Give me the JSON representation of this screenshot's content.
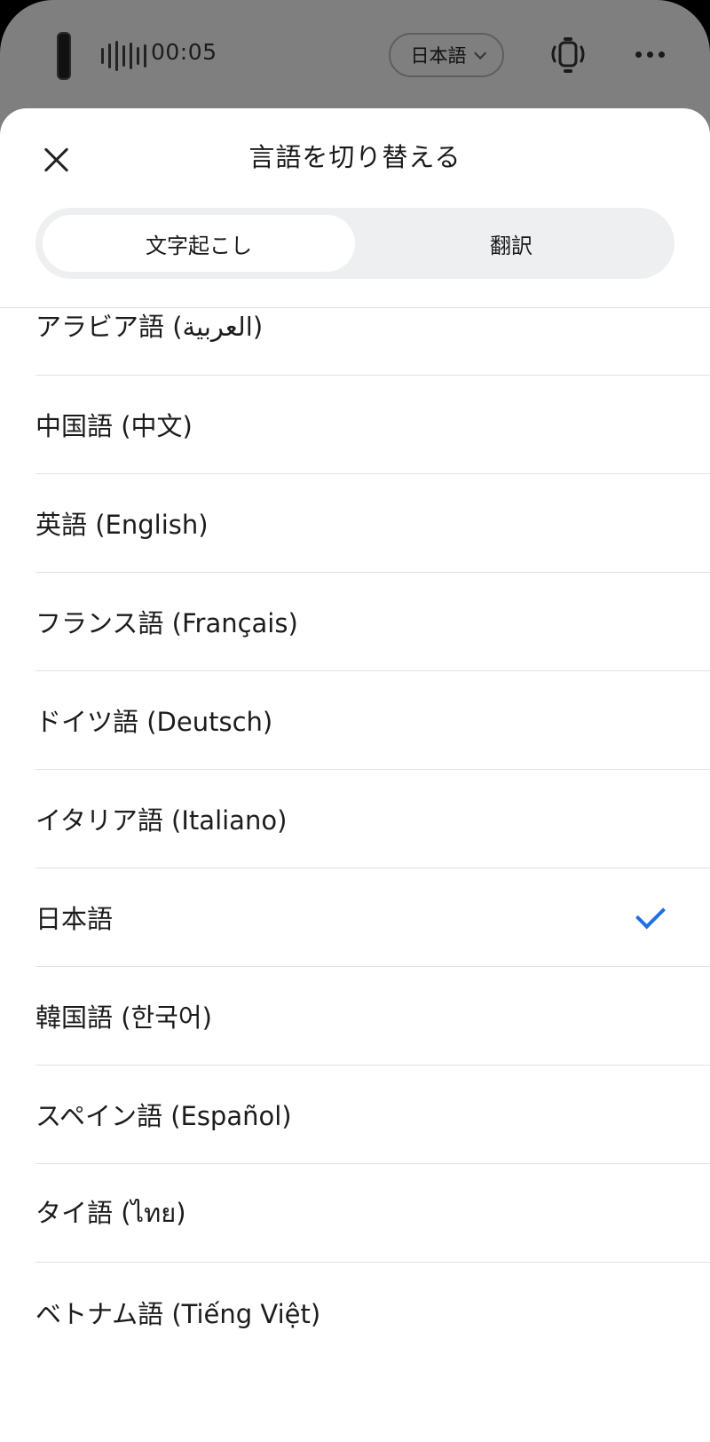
{
  "recorder": {
    "timer": "00:05",
    "language_pill": "日本語",
    "icons": {
      "device": "recorder-device-icon",
      "wave": "waveform-icon",
      "camera": "camera-icon",
      "more": "more-icon",
      "chevron": "chevron-down-icon"
    }
  },
  "sheet": {
    "title": "言語を切り替える",
    "tabs": [
      {
        "label": "文字起こし",
        "active": true
      },
      {
        "label": "翻訳",
        "active": false
      }
    ],
    "languages": [
      {
        "label": "アラビア語 (العربية)",
        "selected": false
      },
      {
        "label": "中国語 (中文)",
        "selected": false
      },
      {
        "label": "英語 (English)",
        "selected": false
      },
      {
        "label": "フランス語 (Français)",
        "selected": false
      },
      {
        "label": "ドイツ語 (Deutsch)",
        "selected": false
      },
      {
        "label": "イタリア語 (Italiano)",
        "selected": false
      },
      {
        "label": "日本語",
        "selected": true
      },
      {
        "label": "韓国語 (한국어)",
        "selected": false
      },
      {
        "label": "スペイン語 (Español)",
        "selected": false
      },
      {
        "label": "タイ語 (ไทย)",
        "selected": false
      },
      {
        "label": "ベトナム語 (Tiếng Việt)",
        "selected": false
      }
    ]
  },
  "colors": {
    "accent": "#1f6fe5",
    "overlay": "#7f7f7f",
    "segment_bg": "#eeeff1"
  }
}
